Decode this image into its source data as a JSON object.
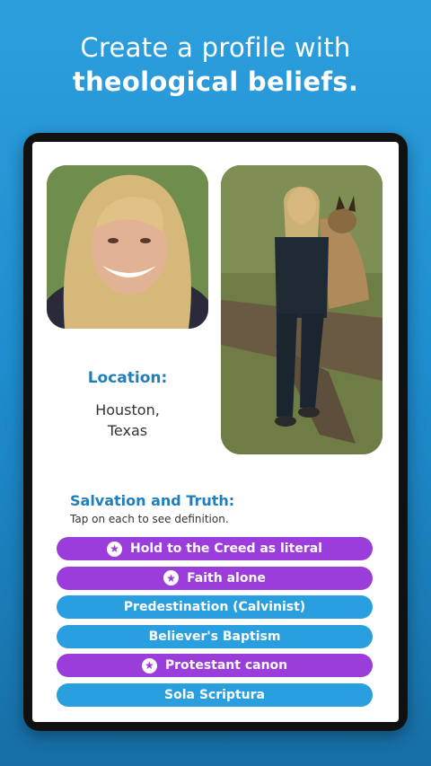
{
  "headline": {
    "line1": "Create a profile with",
    "line2": "theological beliefs."
  },
  "profile": {
    "photos": [
      {
        "name": "profile-photo-portrait"
      },
      {
        "name": "profile-photo-with-dog"
      }
    ],
    "location_label": "Location:",
    "location_line1": "Houston,",
    "location_line2": "Texas"
  },
  "section": {
    "title": "Salvation and Truth:",
    "subtitle": "Tap on each to see definition."
  },
  "beliefs": [
    {
      "label": "Hold to the Creed as literal",
      "color": "#9b3ddb",
      "starred": true
    },
    {
      "label": "Faith alone",
      "color": "#9b3ddb",
      "starred": true
    },
    {
      "label": "Predestination (Calvinist)",
      "color": "#2a9fdf",
      "starred": false
    },
    {
      "label": "Believer's Baptism",
      "color": "#2a9fdf",
      "starred": false
    },
    {
      "label": "Protestant canon",
      "color": "#9b3ddb",
      "starred": true
    },
    {
      "label": "Sola Scriptura",
      "color": "#2a9fdf",
      "starred": false
    }
  ],
  "colors": {
    "accent_blue": "#1d7fc0",
    "purple": "#9b3ddb",
    "light_blue": "#2a9fdf"
  }
}
